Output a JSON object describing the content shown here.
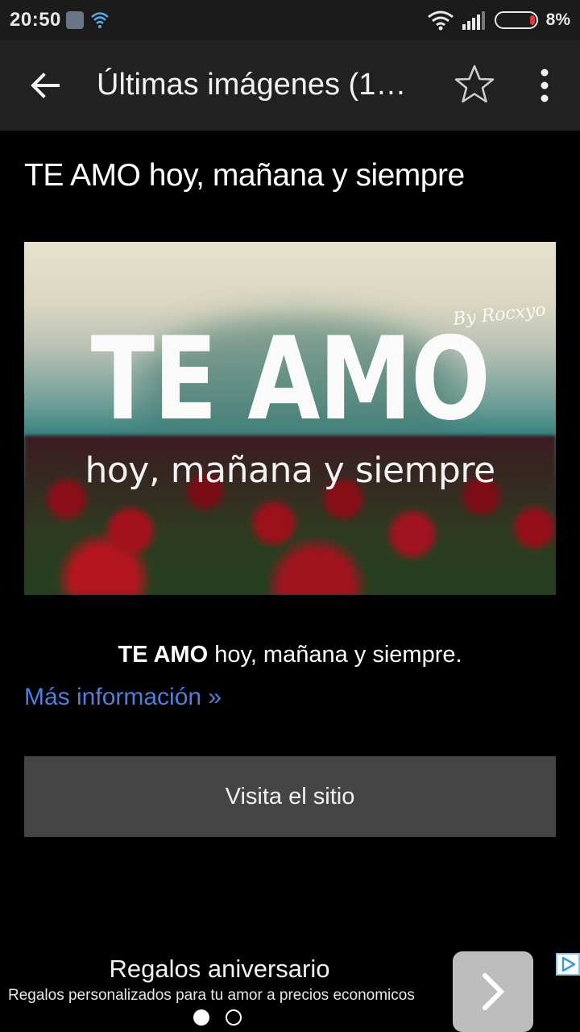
{
  "status_bar": {
    "time": "20:50",
    "battery_percent": "8%",
    "icons": [
      "app-notification-icon",
      "wifi-icon",
      "signal-icon",
      "battery-icon"
    ]
  },
  "app_bar": {
    "title": "Últimas imágenes (1…",
    "icons": [
      "back-arrow-icon",
      "star-outline-icon",
      "more-vert-icon"
    ]
  },
  "post": {
    "title": "TE AMO hoy, mañana y siempre",
    "image": {
      "main_text": "TE AMO",
      "sub_text": "hoy, mañana y siempre",
      "signature": "By Rocxyo"
    },
    "caption_bold": "TE AMO",
    "caption_rest": " hoy, mañana y siempre.",
    "more_link": "Más información »",
    "visit_button": "Visita el sitio"
  },
  "ad": {
    "title": "Regalos aniversario",
    "text": "Regalos personalizados para tu amor a precios economicos",
    "carousel": {
      "pages": 2,
      "active": 1
    }
  },
  "colors": {
    "app_bar": "#212121",
    "link": "#4f7fdc",
    "button": "#454545",
    "battery_low": "#e53935"
  }
}
